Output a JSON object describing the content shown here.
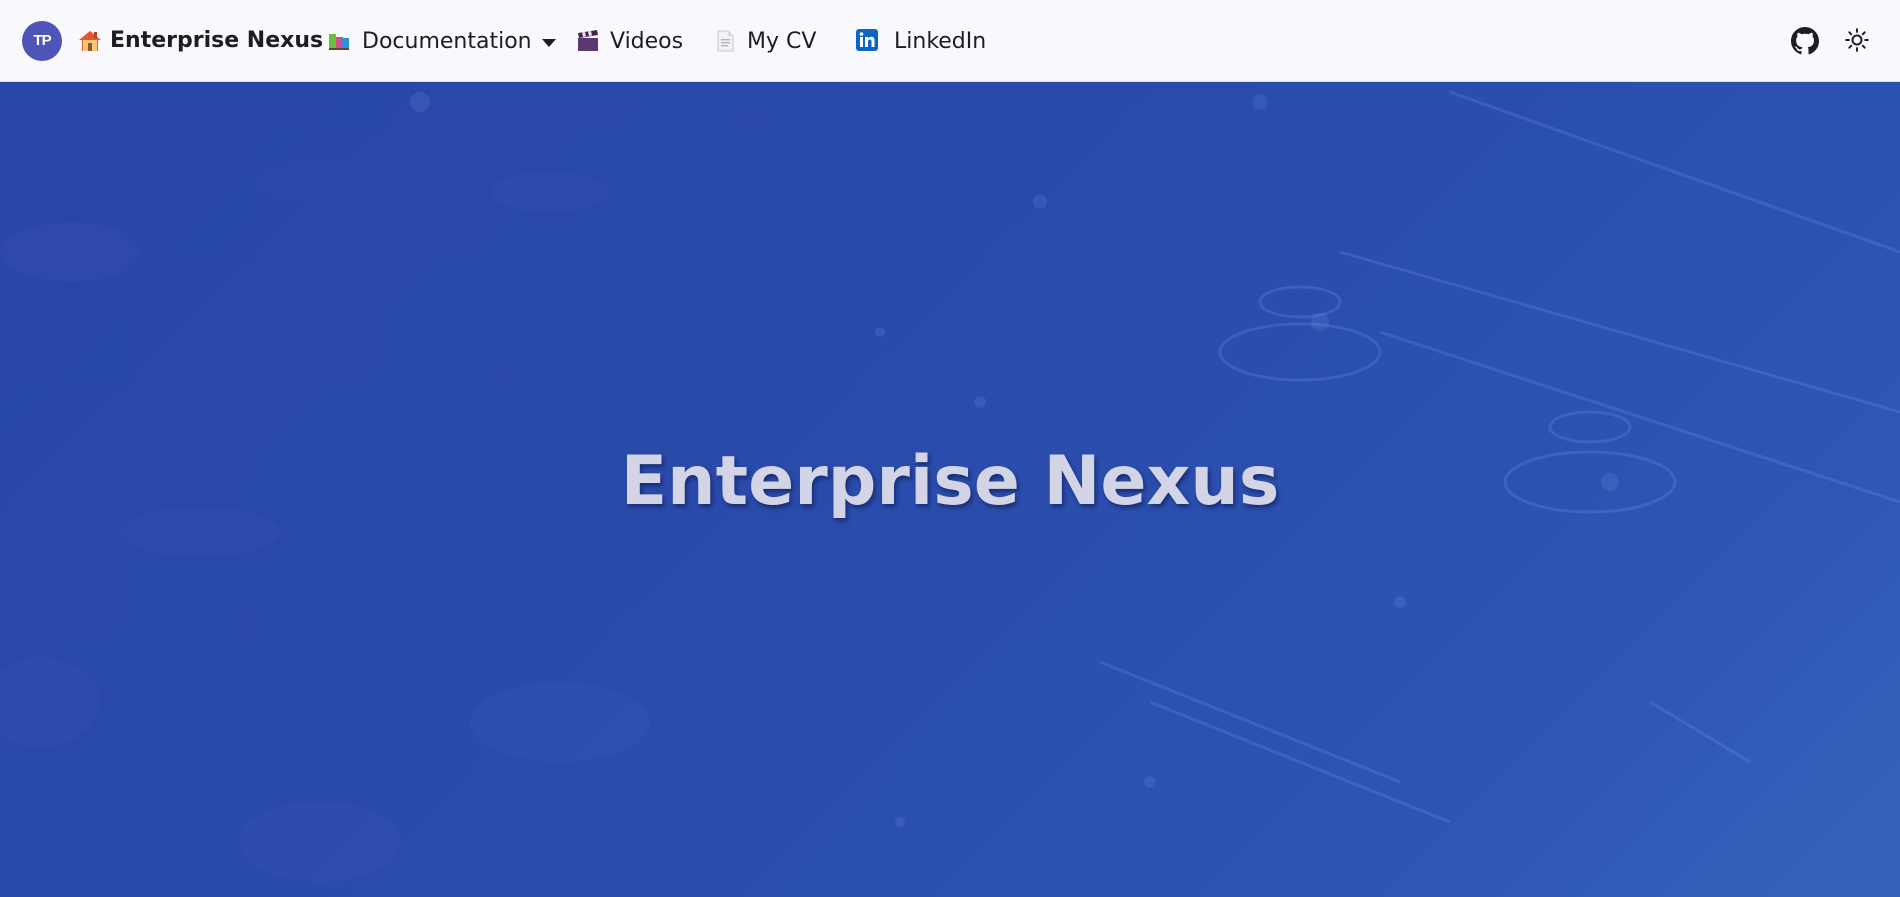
{
  "navbar": {
    "avatar_initials": "TP",
    "brand_title": "Enterprise Nexus",
    "items": [
      {
        "label": "Documentation",
        "icon": "books-icon",
        "has_dropdown": true
      },
      {
        "label": "Videos",
        "icon": "clapper-board-icon"
      },
      {
        "label": "My CV",
        "icon": "document-icon"
      },
      {
        "label": "LinkedIn",
        "icon": "linkedin-icon"
      }
    ],
    "right_icons": [
      "github-icon",
      "sun-icon"
    ]
  },
  "hero": {
    "title": "Enterprise Nexus"
  },
  "colors": {
    "navbar_bg": "#f8f8fd",
    "avatar_bg": "#4e55b9",
    "hero_bg": "#2a4aa8",
    "hero_title": "#d3d5e6",
    "linkedin_blue": "#0a66c2"
  }
}
